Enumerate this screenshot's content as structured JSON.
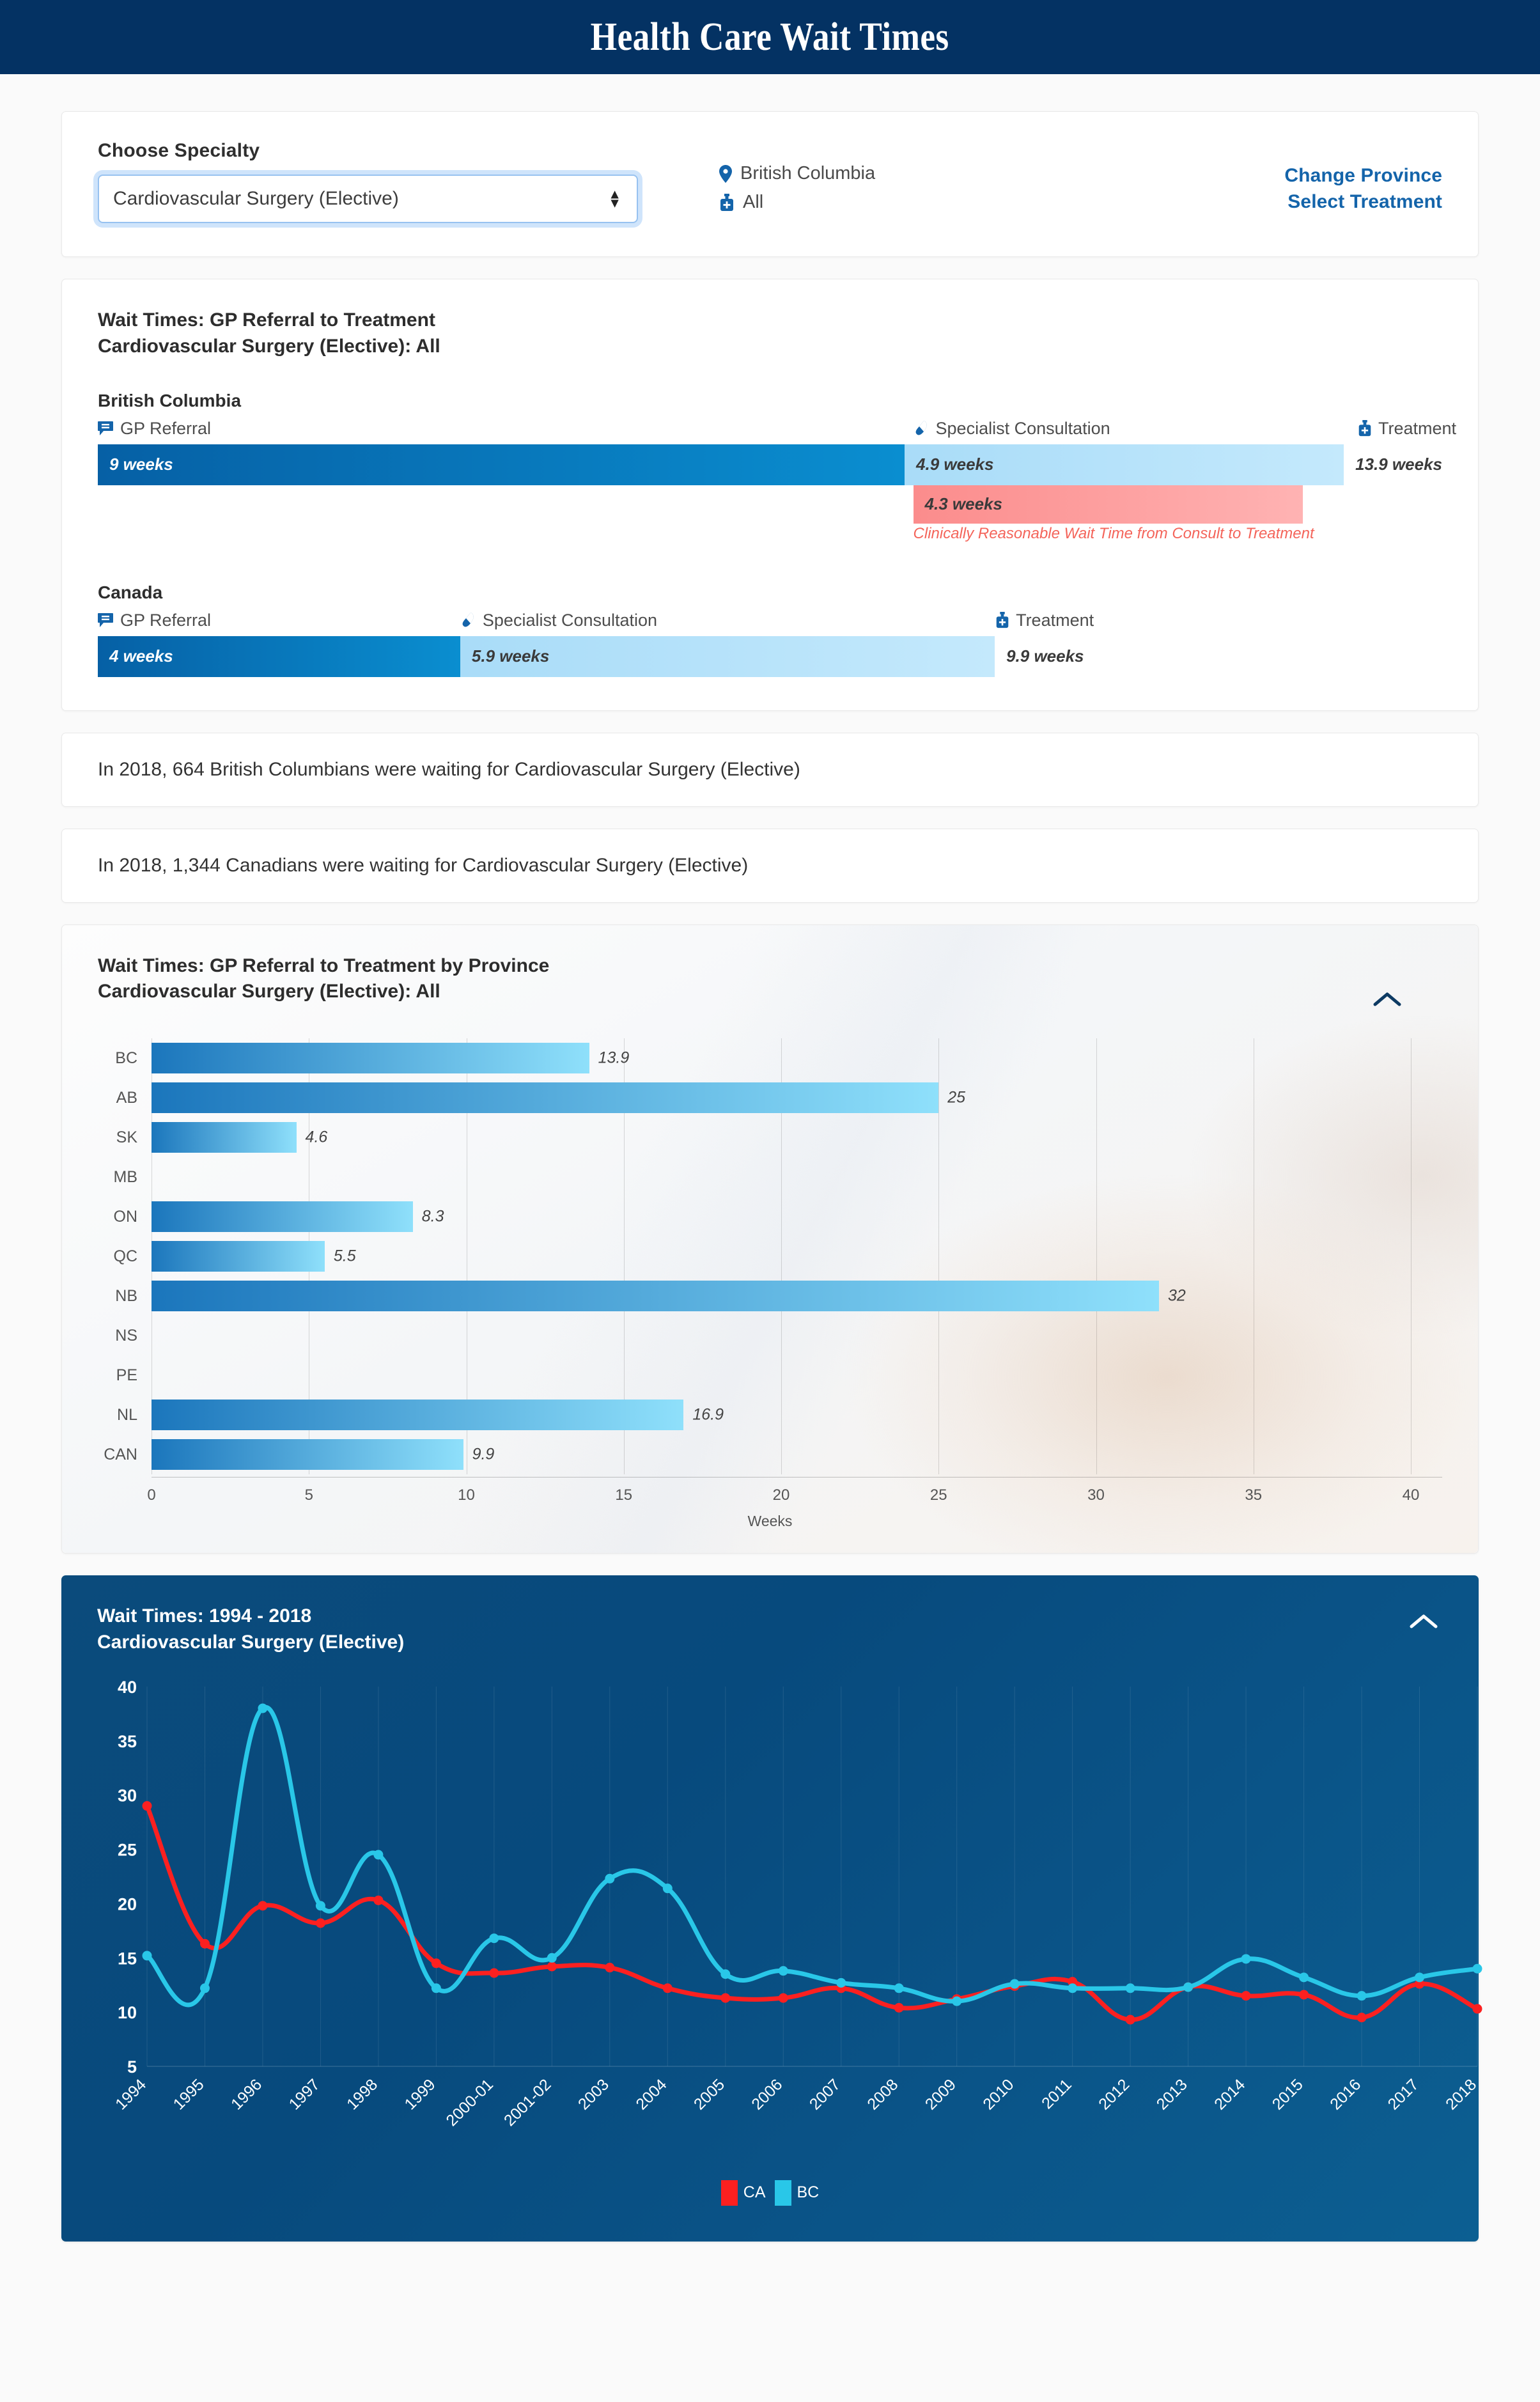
{
  "header": {
    "title": "Health Care Wait Times"
  },
  "selector": {
    "label": "Choose Specialty",
    "value": "Cardiovascular Surgery (Elective)",
    "province": "British Columbia",
    "treatment": "All",
    "change_province_label": "Change Province",
    "select_treatment_label": "Select Treatment"
  },
  "wait_times": {
    "title_line1": "Wait Times: GP Referral to Treatment",
    "title_line2": "Cardiovascular Surgery (Elective): All",
    "legend": {
      "gp_referral": "GP Referral",
      "specialist_consultation": "Specialist Consultation",
      "treatment": "Treatment"
    },
    "bc": {
      "region": "British Columbia",
      "gp_referral_value": "9 weeks",
      "consultation_value": "4.9 weeks",
      "total_value": "13.9 weeks",
      "crwt_value": "4.3 weeks",
      "crwt_note": "Clinically Reasonable Wait Time from Consult to Treatment",
      "gp_weeks": 9,
      "consult_weeks": 4.9,
      "total_weeks": 13.9,
      "crwt_weeks": 4.3
    },
    "canada": {
      "region": "Canada",
      "gp_referral_value": "4 weeks",
      "consultation_value": "5.9 weeks",
      "total_value": "9.9 weeks",
      "gp_weeks": 4,
      "consult_weeks": 5.9,
      "total_weeks": 9.9
    }
  },
  "info_cards": [
    "In 2018, 664 British Columbians were waiting for Cardiovascular Surgery (Elective)",
    "In 2018, 1,344 Canadians were waiting for Cardiovascular Surgery (Elective)"
  ],
  "province_chart": {
    "title_line1": "Wait Times: GP Referral to Treatment by Province",
    "title_line2": "Cardiovascular Surgery (Elective): All"
  },
  "trend_chart": {
    "title_line1": "Wait Times: 1994 - 2018",
    "title_line2": "Cardiovascular Surgery (Elective)"
  },
  "colors": {
    "header_bg": "#043263",
    "link_blue": "#1464aa",
    "gp_bar_start": "#0660a5",
    "gp_bar_end": "#0a8ed0",
    "consult_bar_start": "#a9dcf8",
    "consult_bar_end": "#c4e9fc",
    "crwt_bar": "#fb8c8c",
    "crwt_text": "#f4645a",
    "series_ca": "#fc2020",
    "series_bc": "#29c7e8"
  },
  "chart_data": [
    {
      "type": "bar",
      "orientation": "horizontal",
      "title": "Wait Times: GP Referral to Treatment by Province — Cardiovascular Surgery (Elective): All",
      "categories": [
        "BC",
        "AB",
        "SK",
        "MB",
        "ON",
        "QC",
        "NB",
        "NS",
        "PE",
        "NL",
        "CAN"
      ],
      "values": [
        13.9,
        25,
        4.6,
        null,
        8.3,
        5.5,
        32,
        null,
        null,
        16.9,
        9.9
      ],
      "labels": [
        "13.9",
        "25",
        "4.6",
        "",
        "8.3",
        "5.5",
        "32",
        "",
        "",
        "16.9",
        "9.9"
      ],
      "xlabel": "Weeks",
      "ylabel": "",
      "xlim": [
        0,
        40
      ],
      "xticks": [
        0,
        5,
        10,
        15,
        20,
        25,
        30,
        35,
        40
      ],
      "grid": true,
      "legend": "none"
    },
    {
      "type": "line",
      "title": "Wait Times: 1994 - 2018 — Cardiovascular Surgery (Elective)",
      "x": [
        "1994",
        "1995",
        "1996",
        "1997",
        "1998",
        "1999",
        "2000-01",
        "2001-02",
        "2003",
        "2004",
        "2005",
        "2006",
        "2007",
        "2008",
        "2009",
        "2010",
        "2011",
        "2012",
        "2013",
        "2014",
        "2015",
        "2016",
        "2017",
        "2018"
      ],
      "series": [
        {
          "name": "CA",
          "color": "#fc2020",
          "values": [
            29.0,
            16.3,
            19.8,
            18.2,
            20.3,
            14.5,
            13.6,
            14.2,
            14.1,
            12.2,
            11.3,
            11.3,
            12.2,
            10.4,
            11.2,
            12.4,
            12.8,
            9.3,
            12.3,
            11.5,
            11.6,
            9.5,
            12.6,
            10.3
          ]
        },
        {
          "name": "BC",
          "color": "#29c7e8",
          "values": [
            15.2,
            12.2,
            38.0,
            19.8,
            24.5,
            12.2,
            16.8,
            15.0,
            22.3,
            21.4,
            13.5,
            13.8,
            12.7,
            12.2,
            11.0,
            12.6,
            12.2,
            12.2,
            12.3,
            14.9,
            13.2,
            11.5,
            13.2,
            14.0
          ]
        }
      ],
      "ylabel": "",
      "xlabel": "",
      "ylim": [
        5,
        40
      ],
      "yticks": [
        5,
        10,
        15,
        20,
        25,
        30,
        35,
        40
      ],
      "grid": true,
      "legend": "bottom-center"
    }
  ]
}
